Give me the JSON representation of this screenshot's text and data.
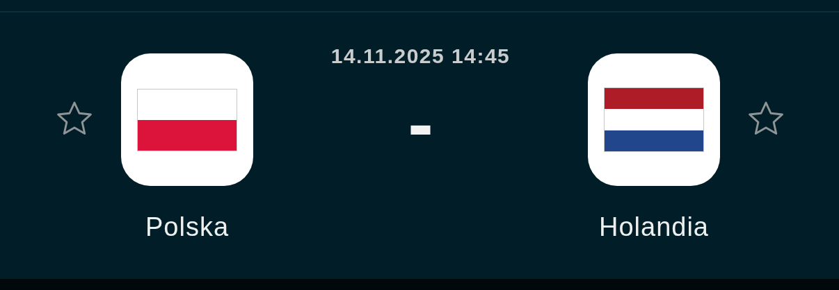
{
  "match": {
    "datetime": "14.11.2025 14:45",
    "score": "-"
  },
  "teams": [
    {
      "name": "Polska",
      "favorite": false,
      "kind": "bicolor"
    },
    {
      "name": "Holandia",
      "favorite": false,
      "kind": "tricolor"
    }
  ]
}
